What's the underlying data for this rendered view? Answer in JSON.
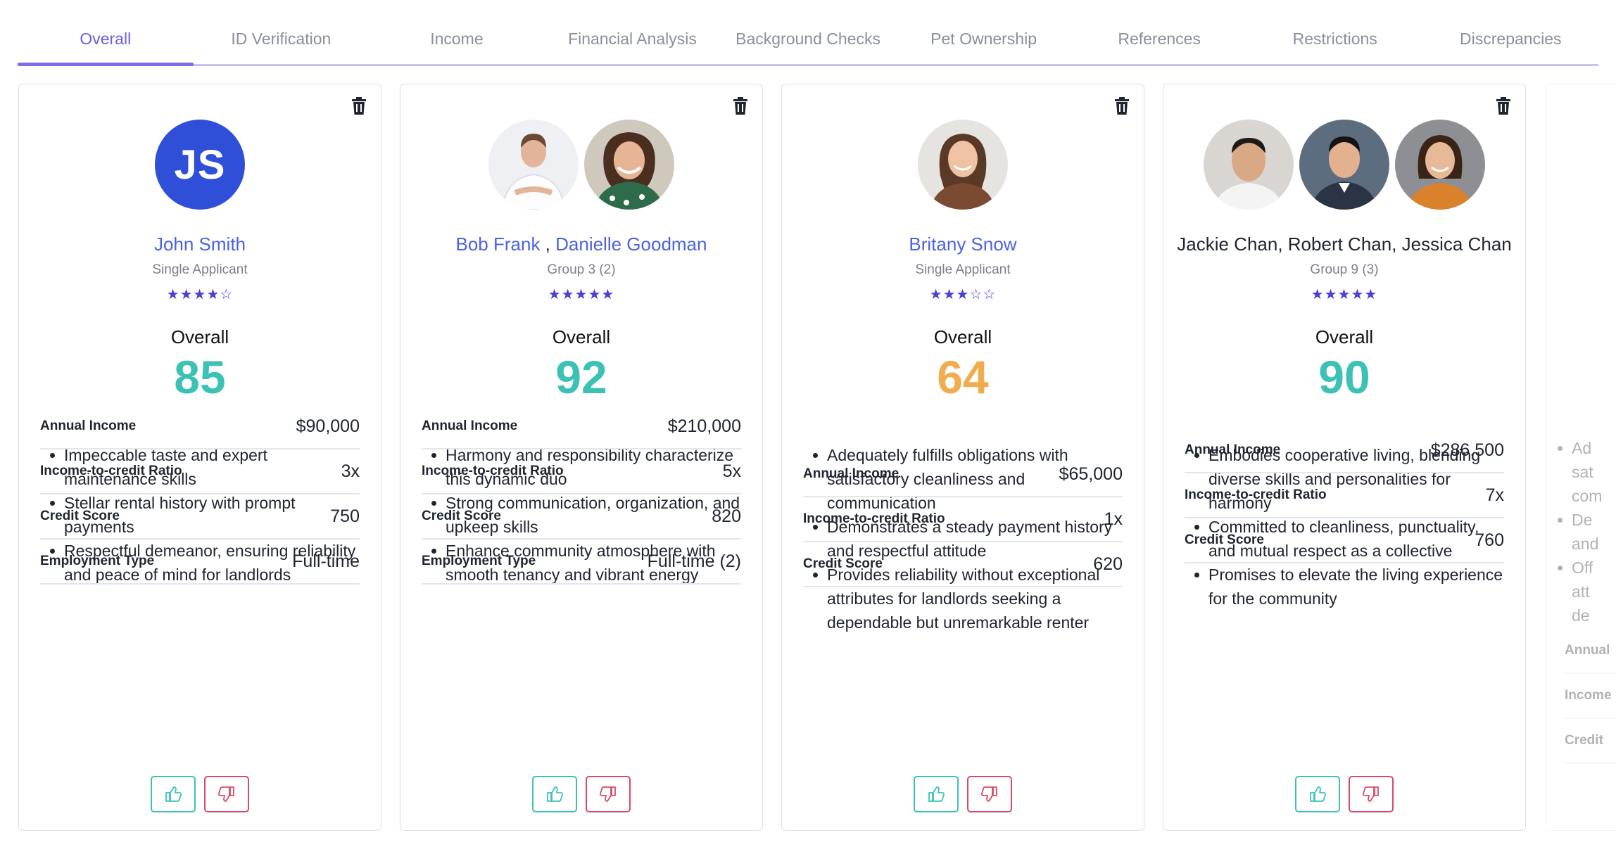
{
  "tabs": [
    "Overall",
    "ID Verification",
    "Income",
    "Financial Analysis",
    "Background Checks",
    "Pet Ownership",
    "References",
    "Restrictions",
    "Discrepancies"
  ],
  "active_tab": "Overall",
  "colors": {
    "accent": "#6b5fe0",
    "link": "#4b62e0",
    "score_good": "#3cc2b5",
    "score_mid": "#f0ad4e",
    "dislike": "#d94a6a"
  },
  "overall_label": "Overall",
  "cards": [
    {
      "initials": "JS",
      "names": [
        "John Smith"
      ],
      "names_linked": true,
      "subtitle": "Single Applicant",
      "rating": 4,
      "score": "85",
      "bullets": [
        "Impeccable taste and expert maintenance skills",
        "Stellar rental history with prompt payments",
        "Respectful demeanor, ensuring reliability and peace of mind for landlords"
      ],
      "stats": [
        {
          "label": "Annual Income",
          "value": "$90,000"
        },
        {
          "label": "Income-to-credit Ratio",
          "value": "3x"
        },
        {
          "label": "Credit Score",
          "value": "750"
        },
        {
          "label": "Employment Type",
          "value": "Full-time"
        }
      ]
    },
    {
      "names": [
        "Bob Frank",
        "Danielle Goodman"
      ],
      "names_linked": true,
      "subtitle": "Group 3 (2)",
      "rating": 5,
      "score": "92",
      "bullets": [
        "Harmony and responsibility characterize this dynamic duo",
        "Strong communication, organization, and upkeep skills",
        "Enhance community atmosphere with smooth tenancy and vibrant energy"
      ],
      "stats": [
        {
          "label": "Annual Income",
          "value": "$210,000"
        },
        {
          "label": "Income-to-credit Ratio",
          "value": "5x"
        },
        {
          "label": "Credit Score",
          "value": "820"
        },
        {
          "label": "Employment Type",
          "value": "Full-time (2)"
        }
      ]
    },
    {
      "names": [
        "Britany Snow"
      ],
      "names_linked": true,
      "subtitle": "Single Applicant",
      "rating": 3,
      "score": "64",
      "bullets": [
        "Adequately fulfills obligations with satisfactory cleanliness and communication",
        "Demonstrates a steady payment history and respectful attitude",
        "Provides reliability without exceptional attributes for landlords seeking a dependable but unremarkable renter"
      ],
      "stats": [
        {
          "label": "Annual Income",
          "value": "$65,000"
        },
        {
          "label": "Income-to-credit Ratio",
          "value": "1x"
        },
        {
          "label": "Credit Score",
          "value": "620"
        }
      ]
    },
    {
      "names": [
        "Jackie Chan",
        "Robert Chan",
        "Jessica Chan"
      ],
      "names_linked": false,
      "subtitle": "Group 9 (3)",
      "rating": 5,
      "score": "90",
      "bullets": [
        "Embodies cooperative living, blending diverse skills and personalities for harmony",
        "Committed to cleanliness, punctuality, and mutual respect as a collective",
        "Promises to elevate the living experience for the community"
      ],
      "stats": [
        {
          "label": "Annual Income",
          "value": "$286,500"
        },
        {
          "label": "Income-to-credit Ratio",
          "value": "7x"
        },
        {
          "label": "Credit Score",
          "value": "760"
        }
      ]
    }
  ],
  "ghost_card": {
    "bullet_fragments": [
      "Ad",
      "sat",
      "com",
      "De",
      "and",
      "Off",
      "att",
      "de"
    ],
    "stat_fragments": [
      "Annual",
      "Income",
      "Credit"
    ]
  }
}
